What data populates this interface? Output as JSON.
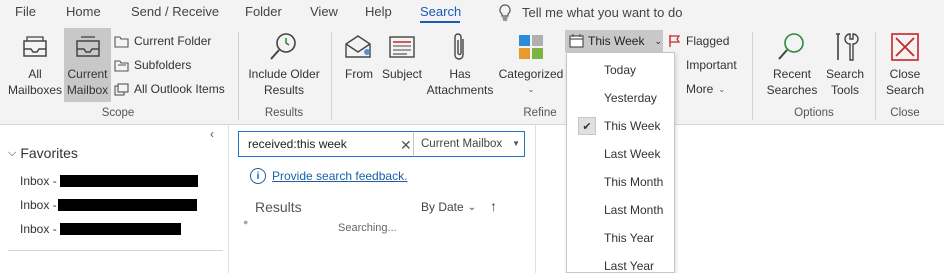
{
  "tabs": [
    {
      "label": "File"
    },
    {
      "label": "Home"
    },
    {
      "label": "Send / Receive"
    },
    {
      "label": "Folder"
    },
    {
      "label": "View"
    },
    {
      "label": "Help"
    },
    {
      "label": "Search"
    }
  ],
  "tell_me": "Tell me what you want to do",
  "ribbon": {
    "scope": {
      "label": "Scope",
      "all_mailboxes": "All Mailboxes",
      "current_mailbox": "Current Mailbox",
      "current_folder": "Current Folder",
      "subfolders": "Subfolders",
      "all_outlook_items": "All Outlook Items"
    },
    "results": {
      "label": "Results",
      "include_older": "Include Older Results"
    },
    "refine": {
      "label": "Refine",
      "from": "From",
      "subject": "Subject",
      "has_attachments": "Has Attachments",
      "categorized": "Categorized",
      "this_week": "This Week",
      "flagged": "Flagged",
      "important": "Important",
      "more": "More"
    },
    "options": {
      "label": "Options",
      "recent_searches": "Recent Searches",
      "search_tools": "Search Tools"
    },
    "close": {
      "label": "Close",
      "close_search": "Close Search"
    }
  },
  "date_menu": {
    "items": [
      {
        "label": "Today"
      },
      {
        "label": "Yesterday"
      },
      {
        "label": "This Week"
      },
      {
        "label": "Last Week"
      },
      {
        "label": "This Month"
      },
      {
        "label": "Last Month"
      },
      {
        "label": "This Year"
      },
      {
        "label": "Last Year"
      }
    ],
    "checked": "This Week"
  },
  "nav": {
    "favorites": "Favorites",
    "inbox_rows": [
      {
        "label": "Inbox - "
      },
      {
        "label": "Inbox - "
      },
      {
        "label": "Inbox - "
      }
    ]
  },
  "search": {
    "query": "received:this week",
    "scope": "Current Mailbox",
    "feedback": "Provide search feedback.",
    "results_label": "Results",
    "sort_label": "By Date",
    "status": "Searching..."
  },
  "colors": {
    "accent": "#185abd",
    "ribbon_bg": "#f3f3f3",
    "close_red": "#c8262b"
  }
}
